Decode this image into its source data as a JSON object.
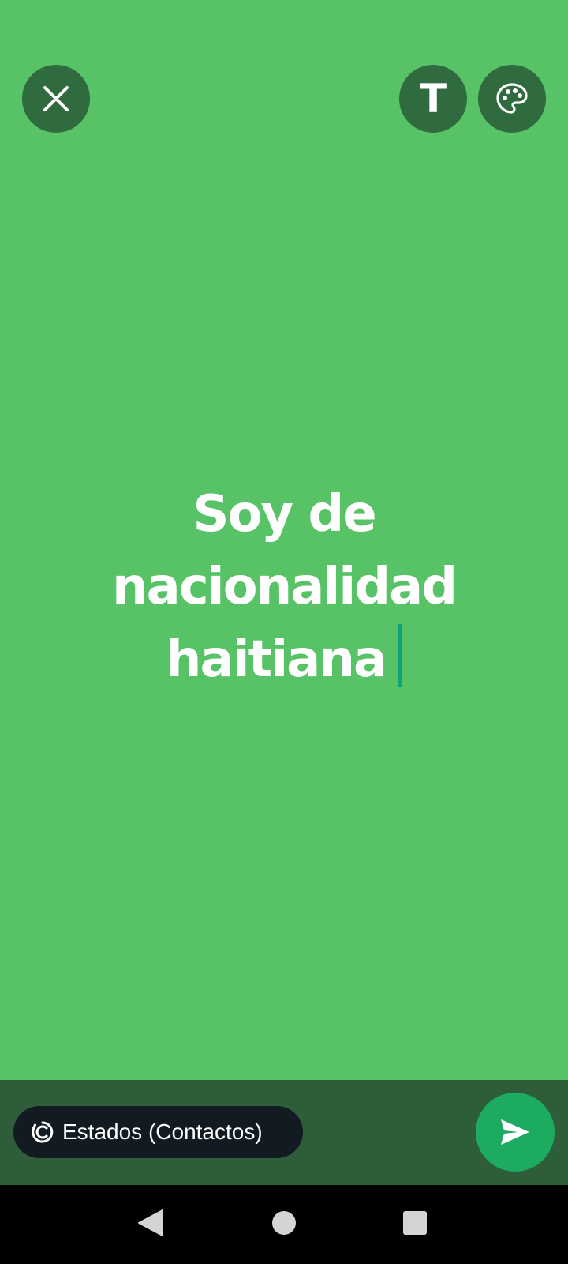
{
  "editor": {
    "lines": [
      "Soy de",
      "nacionalidad",
      "haitiana"
    ],
    "text_color": "#ffffff",
    "cursor_color": "#12a37a"
  },
  "toolbar": {
    "close_icon": "close-icon",
    "text_style_label": "T",
    "palette_icon": "palette-icon"
  },
  "footer": {
    "audience_label": "Estados (Contactos)",
    "audience_icon": "status-ring-icon",
    "send_icon": "send-icon"
  },
  "nav": {
    "back_icon": "back-triangle-icon",
    "home_icon": "home-circle-icon",
    "recents_icon": "recents-square-icon"
  },
  "colors": {
    "background": "#57c266",
    "button": "#2f6b3e",
    "bottom_bar": "#2d5e39",
    "chip": "#111b21",
    "send": "#1daa61"
  }
}
